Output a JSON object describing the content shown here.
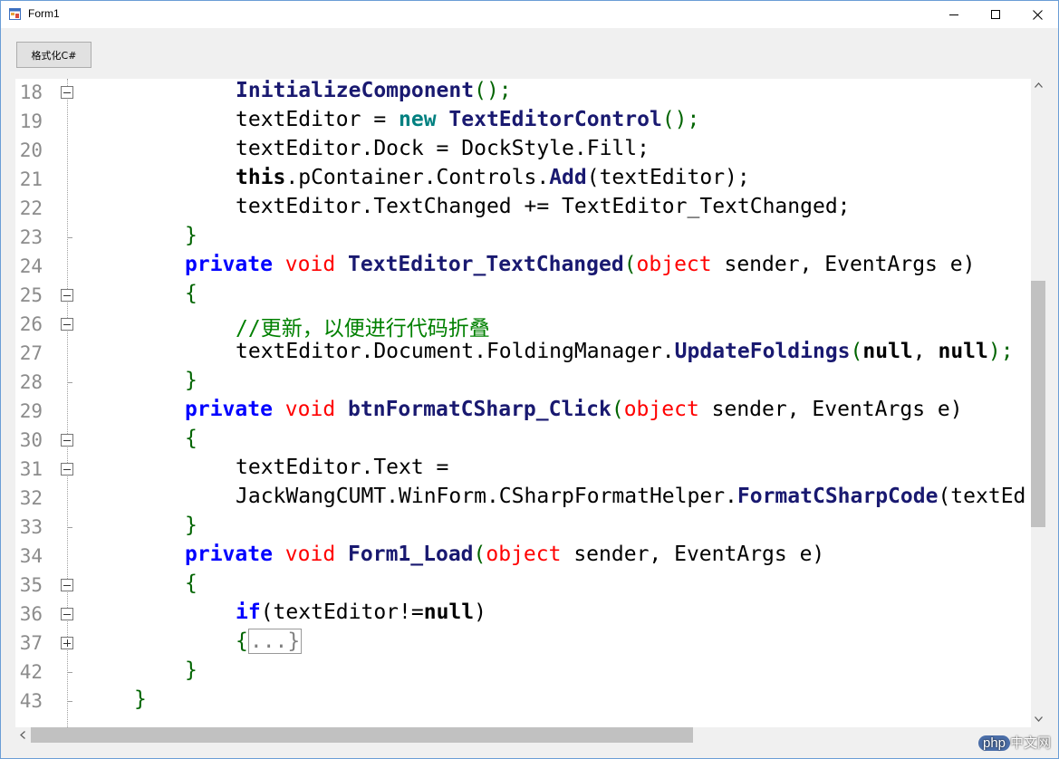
{
  "window": {
    "title": "Form1",
    "minimize_icon": "minimize-icon",
    "maximize_icon": "maximize-icon",
    "close_icon": "close-icon"
  },
  "toolbar": {
    "format_button_label": "格式化C#"
  },
  "editor": {
    "lines": [
      {
        "num": "18",
        "fold": "minus"
      },
      {
        "num": "19",
        "fold": "none"
      },
      {
        "num": "20",
        "fold": "none"
      },
      {
        "num": "21",
        "fold": "none"
      },
      {
        "num": "22",
        "fold": "none"
      },
      {
        "num": "23",
        "fold": "end"
      },
      {
        "num": "24",
        "fold": "none"
      },
      {
        "num": "25",
        "fold": "minus"
      },
      {
        "num": "26",
        "fold": "minus"
      },
      {
        "num": "27",
        "fold": "none"
      },
      {
        "num": "28",
        "fold": "end"
      },
      {
        "num": "29",
        "fold": "none"
      },
      {
        "num": "30",
        "fold": "minus"
      },
      {
        "num": "31",
        "fold": "minus"
      },
      {
        "num": "32",
        "fold": "none"
      },
      {
        "num": "33",
        "fold": "end"
      },
      {
        "num": "34",
        "fold": "none"
      },
      {
        "num": "35",
        "fold": "minus"
      },
      {
        "num": "36",
        "fold": "minus"
      },
      {
        "num": "37",
        "fold": "plus"
      },
      {
        "num": "42",
        "fold": "end"
      },
      {
        "num": "43",
        "fold": "end"
      }
    ],
    "code": {
      "l18_method": "InitializeComponent",
      "l18_rest": "();",
      "l19_a": "textEditor = ",
      "l19_new": "new",
      "l19_type": "TextEditorControl",
      "l19_rest": "();",
      "l20": "textEditor.Dock = DockStyle.Fill;",
      "l21_this": "this",
      "l21_mid": ".pContainer.Controls.",
      "l21_add": "Add",
      "l21_rest": "(textEditor);",
      "l22": "textEditor.TextChanged += TextEditor_TextChanged;",
      "l23": "}",
      "l24_private": "private",
      "l24_void": "void",
      "l24_name": "TextEditor_TextChanged",
      "l24_paren": "(",
      "l24_object": "object",
      "l24_rest": " sender, EventArgs e)",
      "l25": "{",
      "l26": "//更新，以便进行代码折叠",
      "l27_a": "textEditor.Document.FoldingManager.",
      "l27_method": "UpdateFoldings",
      "l27_p1": "(",
      "l27_null1": "null",
      "l27_comma": ", ",
      "l27_null2": "null",
      "l27_end": ");",
      "l28": "}",
      "l29_private": "private",
      "l29_void": "void",
      "l29_name": "btnFormatCSharp_Click",
      "l29_paren": "(",
      "l29_object": "object",
      "l29_rest": " sender, EventArgs e)",
      "l30": "{",
      "l31": "textEditor.Text =",
      "l32_a": "JackWangCUMT.WinForm.CSharpFormatHelper.",
      "l32_method": "FormatCSharpCode",
      "l32_rest": "(textEd",
      "l33": "}",
      "l34_private": "private",
      "l34_void": "void",
      "l34_name": "Form1_Load",
      "l34_paren": "(",
      "l34_object": "object",
      "l34_rest": " sender, EventArgs e)",
      "l35": "{",
      "l36_if": "if",
      "l36_a": "(textEditor!=",
      "l36_null": "null",
      "l36_end": ")",
      "l37_brace": "{",
      "l37_collapsed": "...}",
      "l42": "}",
      "l43": "}"
    }
  },
  "scrollbars": {
    "up_arrow_icon": "chevron-up-icon",
    "down_arrow_icon": "chevron-down-icon"
  },
  "watermark": {
    "text": "中文网",
    "badge": "php"
  }
}
